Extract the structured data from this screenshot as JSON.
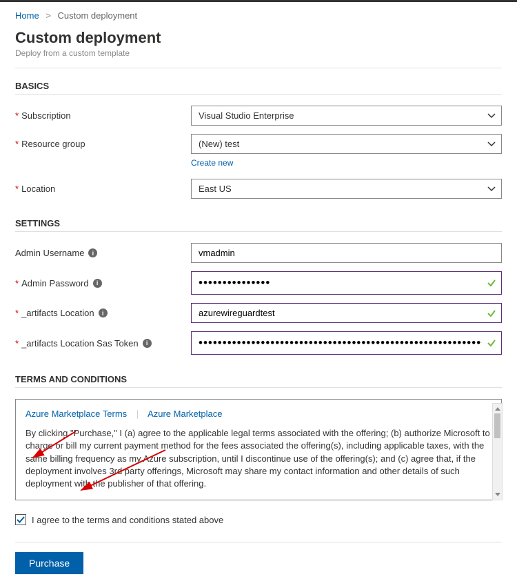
{
  "breadcrumb": {
    "home": "Home",
    "current": "Custom deployment"
  },
  "header": {
    "title": "Custom deployment",
    "subtitle": "Deploy from a custom template"
  },
  "basics": {
    "section_title": "BASICS",
    "subscription": {
      "label": "Subscription",
      "value": "Visual Studio Enterprise"
    },
    "resource_group": {
      "label": "Resource group",
      "value": "(New) test",
      "create_new": "Create new"
    },
    "location": {
      "label": "Location",
      "value": "East US"
    }
  },
  "settings": {
    "section_title": "SETTINGS",
    "admin_username": {
      "label": "Admin Username",
      "value": "vmadmin"
    },
    "admin_password": {
      "label": "Admin Password",
      "value": "•••••••••••••••"
    },
    "artifacts_location": {
      "label": "_artifacts Location",
      "value": "azurewireguardtest"
    },
    "artifacts_sas": {
      "label": "_artifacts Location Sas Token",
      "value": "••••••••••••••••••••••••••••••••••••••••••••••••••••••••••••••••••••••••••••"
    }
  },
  "terms": {
    "section_title": "TERMS AND CONDITIONS",
    "link1": "Azure Marketplace Terms",
    "link2": "Azure Marketplace",
    "body": "By clicking \"Purchase,\" I (a) agree to the applicable legal terms associated with the offering; (b) authorize Microsoft to charge or bill my current payment method for the fees associated the offering(s), including applicable taxes, with the same billing frequency as my Azure subscription, until I discontinue use of the offering(s); and (c) agree that, if the deployment involves 3rd party offerings, Microsoft may share my contact information and other details of such deployment with the publisher of that offering.",
    "agree_label": "I agree to the terms and conditions stated above"
  },
  "actions": {
    "purchase": "Purchase"
  }
}
